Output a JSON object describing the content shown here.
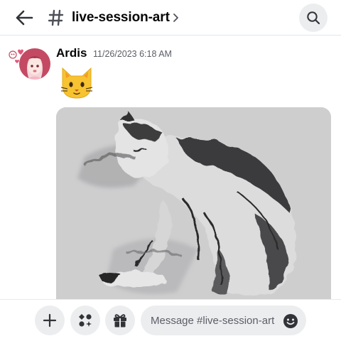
{
  "header": {
    "channel_name": "live-session-art",
    "icons": {
      "back": "arrow-left-icon",
      "hash": "hash-icon",
      "chevron": "chevron-right-icon",
      "search": "search-icon"
    }
  },
  "message": {
    "author": "Ardis",
    "timestamp": "11/26/2023 6:18 AM",
    "emoji": "cat-face-emoji",
    "attachment": "sleeping-cat-sketch-image"
  },
  "composer": {
    "placeholder": "Message #live-session-art",
    "icons": {
      "add": "plus-icon",
      "apps": "apps-icon",
      "gift": "gift-icon",
      "emoji": "smiley-icon"
    }
  },
  "colors": {
    "button_bg": "#ebedef",
    "text_primary": "#060607",
    "text_muted": "#5c5e66"
  }
}
